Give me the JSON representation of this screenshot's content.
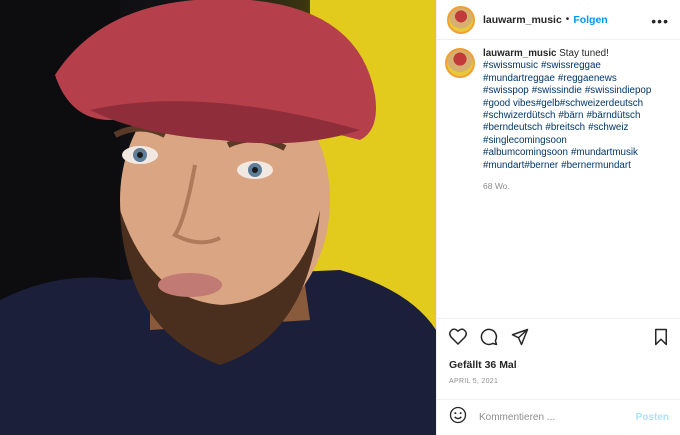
{
  "post": {
    "username": "lauwarm_music",
    "separator": "•",
    "follow_label": "Folgen",
    "more_icon": "•••",
    "caption_text": "Stay tuned!",
    "hashtags": [
      "#swissmusic",
      "#swissreggae",
      "#mundartreggae",
      "#reggaenews",
      "#swisspop",
      "#swissindie",
      "#swissindiepop",
      "#good vibes#gelb#schweizerdeutsch",
      "#schwizerdütsch",
      "#bärn",
      "#bärndütsch",
      "#berndeutsch",
      "#breitsch",
      "#schweiz",
      "#singlecomingsoon",
      "#albumcomingsoon",
      "#mundartmusik",
      "#mundart#berner",
      "#bernermundart"
    ],
    "time_ago": "68 Wo.",
    "likes": "Gefällt 36 Mal",
    "date": "APRIL 5, 2021",
    "comment_placeholder": "Kommentieren ...",
    "post_label": "Posten"
  },
  "icons": {
    "like": "heart-icon",
    "comment": "comment-icon",
    "share": "share-icon",
    "save": "bookmark-icon",
    "emoji": "smiley-icon"
  },
  "colors": {
    "accent": "#0095f6",
    "hashtag": "#00376b",
    "muted": "#8e8e8e",
    "post_disabled": "#b2dffc"
  }
}
